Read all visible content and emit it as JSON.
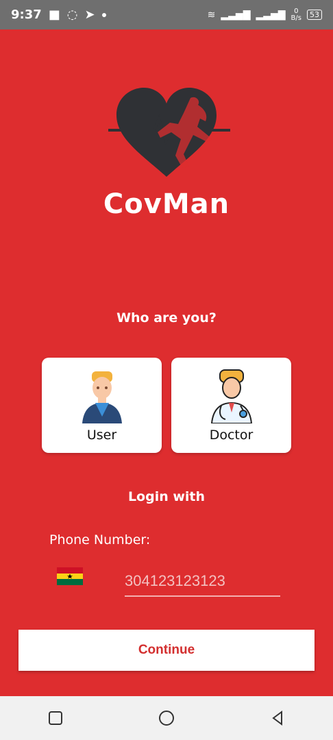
{
  "status_bar": {
    "time": "9:37",
    "network_speed_value": "0",
    "network_speed_unit": "B/s",
    "battery": "53"
  },
  "app": {
    "name": "CovMan"
  },
  "role_select": {
    "question": "Who are you?",
    "options": [
      {
        "label": "User",
        "icon": "user-avatar-icon"
      },
      {
        "label": "Doctor",
        "icon": "doctor-avatar-icon"
      }
    ]
  },
  "login": {
    "title": "Login with",
    "phone_label": "Phone Number:",
    "phone_placeholder": "304123123123",
    "country_flag": "ghana-flag-icon",
    "continue_label": "Continue"
  },
  "colors": {
    "background": "#de2d2f",
    "accent_text": "#d32f2f",
    "card": "#ffffff"
  },
  "nav": {
    "icons": [
      "recent-apps-icon",
      "home-icon",
      "back-icon"
    ]
  }
}
